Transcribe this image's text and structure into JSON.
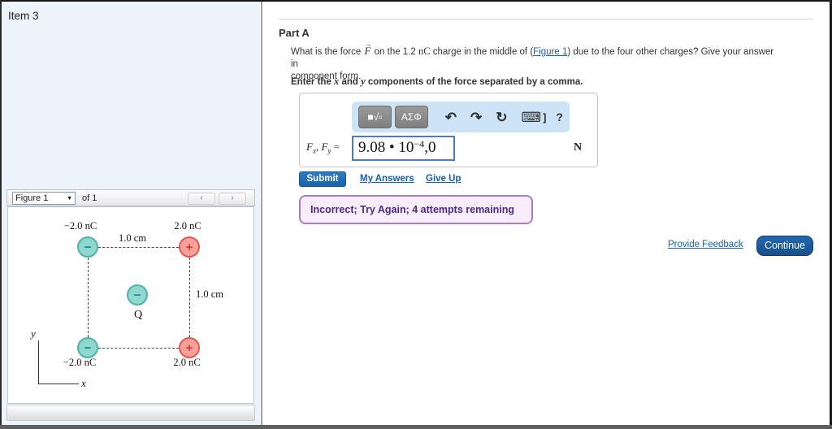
{
  "item": {
    "title": "Item 3"
  },
  "figure_panel": {
    "dropdown_value": "Figure 1",
    "dropdown_arrow": "▼",
    "of_text": "of 1",
    "prev_label": "‹",
    "next_label": "›",
    "figure": {
      "top_left_charge_label": "−2.0 nC",
      "top_right_charge_label": "2.0 nC",
      "bottom_left_charge_label": "−2.0 nC",
      "bottom_right_charge_label": "2.0 nC",
      "top_distance_label": "1.0 cm",
      "right_distance_label": "1.0 cm",
      "center_charge_label": "Q",
      "minus_sign": "−",
      "plus_sign": "+",
      "x_axis_label": "x",
      "y_axis_label": "y"
    }
  },
  "part_a": {
    "heading": "Part A",
    "question": {
      "seg1": "What is the force ",
      "vector_arrow": "→",
      "force_symbol": "F",
      "seg2": " on the 1.2 ",
      "unit_nC": "nC",
      "seg3": " charge in the middle of (",
      "figure_link": "Figure 1",
      "seg4": ") due to the four other charges? Give your answer in",
      "seg5": "component form."
    },
    "instruction": {
      "seg1": "Enter the ",
      "var_x": "x",
      "seg2": " and ",
      "var_y": "y",
      "seg3": " components of the force separated by a comma."
    },
    "toolbar": {
      "templates_icon": "■√▫",
      "greek_icon": "ΑΣΦ",
      "undo_icon": "↶",
      "redo_icon": "↷",
      "reset_icon": "↻",
      "keyboard_icon": "⌨",
      "bracket": "]",
      "help_icon": "?"
    },
    "answer": {
      "label_f1": "F",
      "label_sub1": "x",
      "label_comma": ", ",
      "label_f2": "F",
      "label_sub2": "y",
      "label_eq": " = ",
      "value_coeff": "9.08",
      "value_dot": " • ",
      "value_base": "10",
      "value_exp": "−4",
      "value_rest": ",0",
      "unit": "N"
    },
    "actions": {
      "submit": "Submit",
      "my_answers": "My Answers",
      "give_up": "Give Up"
    },
    "feedback_message": "Incorrect; Try Again; 4 attempts remaining",
    "footer": {
      "provide_feedback": "Provide Feedback",
      "continue": "Continue"
    }
  },
  "colors": {
    "left_panel_bg": "#edf3fa",
    "toolbar_bg": "#cde3f6",
    "toolbar_button_gray": "#8c8c8c",
    "submit_blue": "#1862ab",
    "continue_blue": "#174f8c",
    "link_blue": "#1a5dab",
    "feedback_bg": "#f8eefb",
    "feedback_border": "#a87fc5",
    "feedback_text": "#4b2c83",
    "input_border_blue": "#4a7dbd",
    "negative_charge_fill": "#8ed8cf",
    "negative_charge_border": "#4fb3a9",
    "positive_charge_fill": "#f7a19a",
    "positive_charge_border": "#e05a51"
  }
}
